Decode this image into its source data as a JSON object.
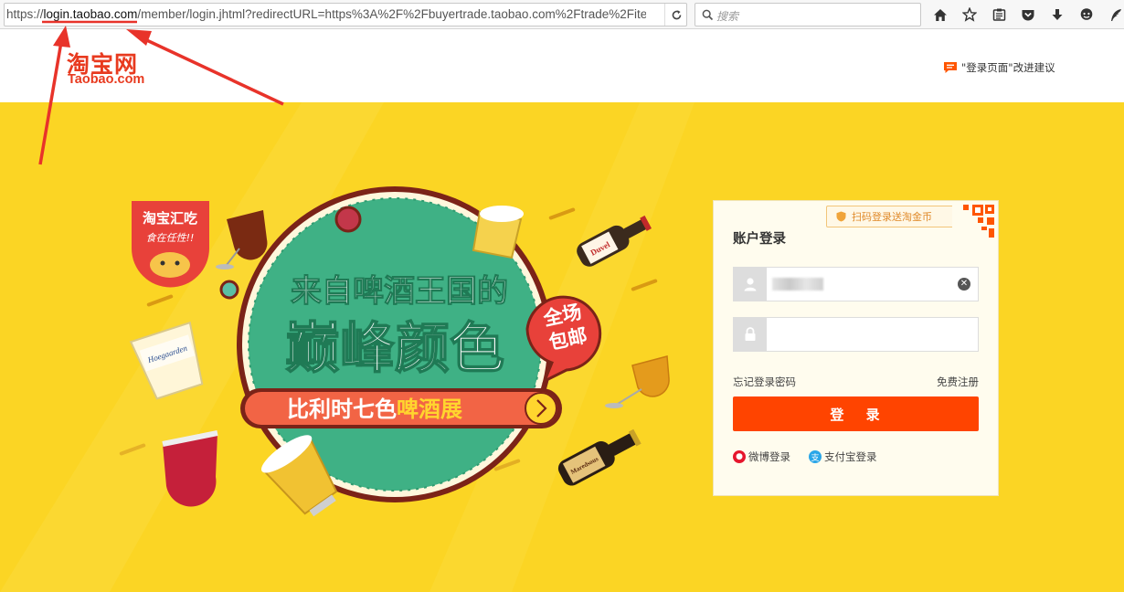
{
  "browser": {
    "url_prefix": "https://",
    "url_domain": "login.taobao.com",
    "url_rest": "/member/login.jhtml?redirectURL=https%3A%2F%2Fbuyertrade.taobao.com%2Ftrade%2Fite",
    "search_placeholder": "搜索",
    "toolbar_icons": [
      "home-icon",
      "star-icon",
      "reading-list-icon",
      "pocket-icon",
      "download-icon",
      "chat-icon",
      "feather-icon"
    ]
  },
  "header": {
    "logo_cn": "淘宝网",
    "logo_en": "Taobao.com",
    "feedback": "\"登录页面\"改进建议"
  },
  "banner": {
    "badge_line1": "淘宝汇吃",
    "badge_line2": "食在任性!!",
    "headline1": "来自啤酒王国的",
    "headline2": "巅峰颜色",
    "tag_line1": "全场",
    "tag_line2": "包邮",
    "subline_a": "比利时七色",
    "subline_b": "啤酒展",
    "bottle_label_1": "Duvel",
    "glass_label": "Hoegaarden",
    "bottle_label_2": "Maredsous"
  },
  "login": {
    "qr_tip": "扫码登录送淘金币",
    "title": "账户登录",
    "username_value": "",
    "password_value": "",
    "forgot": "忘记登录密码",
    "register": "免费注册",
    "submit": "登 录",
    "weibo": "微博登录",
    "alipay": "支付宝登录"
  },
  "colors": {
    "banner": "#fbd524",
    "brand": "#e83a1f",
    "button": "#ff4400",
    "circle": "#3fb185",
    "annotation": "#e8332a"
  }
}
